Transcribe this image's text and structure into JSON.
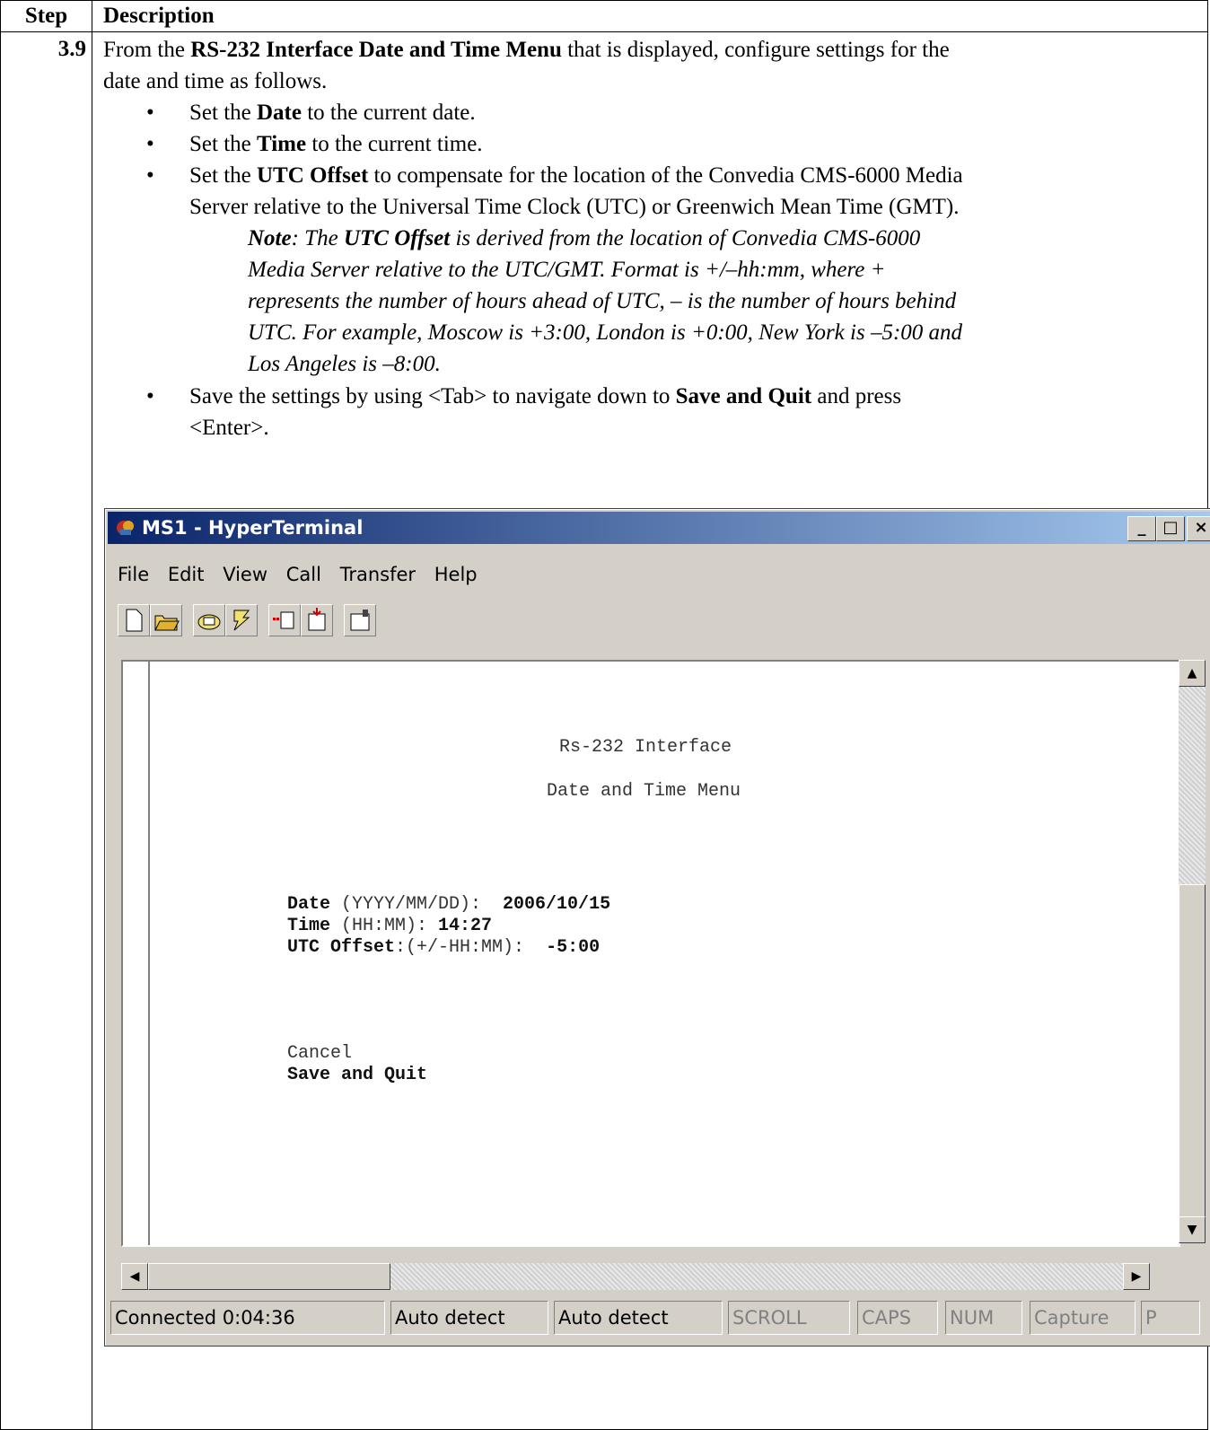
{
  "table": {
    "header_step": "Step",
    "header_description": "Description",
    "step_number": "3.9",
    "intro_line1": [
      "From the ",
      "RS-232 Interface Date and Time Menu",
      " that is displayed, configure settings for the"
    ],
    "intro_line2": "date and time as follows.",
    "bullet_char": "•",
    "bullets": {
      "date": [
        "Set the ",
        "Date",
        " to the current date."
      ],
      "time": [
        "Set the ",
        "Time",
        " to the current time."
      ],
      "utc_line1": [
        "Set the ",
        "UTC Offset",
        " to compensate for the location of the Convedia CMS-6000 Media"
      ],
      "utc_line2": "Server relative to the Universal Time Clock (UTC) or Greenwich Mean Time (GMT).",
      "save_line1": [
        "Save the settings by using <Tab> to navigate down to ",
        "Save and Quit",
        " and press"
      ],
      "save_line2": "<Enter>."
    },
    "note": {
      "line1": [
        "Note",
        ": The ",
        "UTC Offset",
        " is derived from the location of Convedia CMS-6000"
      ],
      "line2": "Media Server relative to the UTC/GMT. Format is +/–hh:mm, where +",
      "line3": "represents the number of hours ahead of UTC, – is the number of hours behind",
      "line4": "UTC. For example, Moscow is +3:00, London is +0:00, New York is –5:00 and",
      "line5": "Los Angeles is –8:00."
    }
  },
  "hyperterminal": {
    "title": "MS1 - HyperTerminal",
    "window_buttons": {
      "minimize": "_",
      "maximize": "□",
      "close": "×"
    },
    "menu": [
      "File",
      "Edit",
      "View",
      "Call",
      "Transfer",
      "Help"
    ],
    "toolbar_icons": [
      "new-icon",
      "open-icon",
      "connect-icon",
      "disconnect-icon",
      "send-icon",
      "receive-icon",
      "properties-icon"
    ],
    "terminal": {
      "heading1": "Rs-232 Interface",
      "heading2": "Date and Time Menu",
      "date_label": "Date",
      "date_format": " (YYYY/MM/DD):  ",
      "date_value": "2006/10/15",
      "time_label": "Time",
      "time_format": " (HH:MM): ",
      "time_value": "14:27",
      "utc_label": "UTC Offset",
      "utc_format": ":(+/-HH:MM):  ",
      "utc_value": "-5:00",
      "cancel": "Cancel",
      "save_quit": "Save and Quit"
    },
    "scroll_arrows": {
      "up": "▲",
      "down": "▼",
      "left": "◀",
      "right": "▶"
    },
    "status": [
      "Connected 0:04:36",
      "Auto detect",
      "Auto detect",
      "SCROLL",
      "CAPS",
      "NUM",
      "Capture",
      "P"
    ]
  }
}
